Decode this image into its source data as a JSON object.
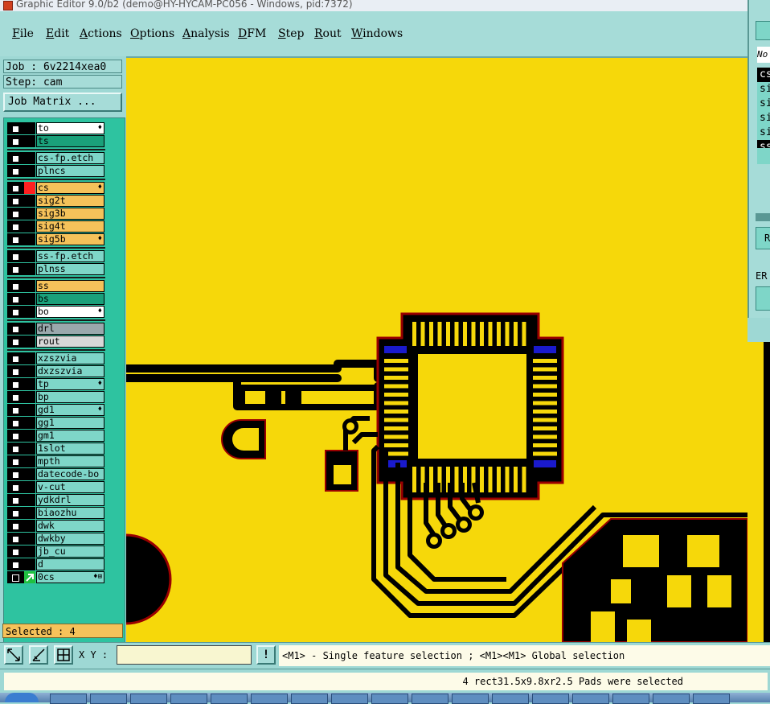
{
  "window": {
    "title": "Graphic Editor 9.0/b2 (demo@HY-HYCAM-PC056 - Windows, pid:7372)"
  },
  "menu": [
    "File",
    "Edit",
    "Actions",
    "Options",
    "Analysis",
    "DFM",
    "Step",
    "Rout",
    "Windows"
  ],
  "job": {
    "label": "Job : 6v2214xea0",
    "step": "Step: cam",
    "matrix_button": "Job Matrix ..."
  },
  "layers": [
    {
      "name": "to",
      "bg": "#ffffff",
      "mark": "♦"
    },
    {
      "name": "ts",
      "bg": "#1aa07a",
      "mark": ""
    },
    {
      "name": "cs-fp.etch",
      "bg": "#7ed6c8",
      "mark": ""
    },
    {
      "name": "plncs",
      "bg": "#7ed6c8",
      "mark": ""
    },
    {
      "name": "cs",
      "bg": "#f5c25a",
      "mark": "♦",
      "color": "#ff2020"
    },
    {
      "name": "sig2t",
      "bg": "#f5c25a",
      "mark": ""
    },
    {
      "name": "sig3b",
      "bg": "#f5c25a",
      "mark": ""
    },
    {
      "name": "sig4t",
      "bg": "#f5c25a",
      "mark": ""
    },
    {
      "name": "sig5b",
      "bg": "#f5c25a",
      "mark": "♦"
    },
    {
      "name": "ss-fp.etch",
      "bg": "#7ed6c8",
      "mark": ""
    },
    {
      "name": "plnss",
      "bg": "#7ed6c8",
      "mark": ""
    },
    {
      "name": "ss",
      "bg": "#f5c25a",
      "mark": ""
    },
    {
      "name": "bs",
      "bg": "#1aa07a",
      "mark": ""
    },
    {
      "name": "bo",
      "bg": "#ffffff",
      "mark": "♦"
    },
    {
      "name": "drl",
      "bg": "#9aa8ac",
      "mark": ""
    },
    {
      "name": "rout",
      "bg": "#d8d8d8",
      "mark": ""
    },
    {
      "name": "xzszvia",
      "bg": "#7ed6c8",
      "mark": ""
    },
    {
      "name": "dxzszvia",
      "bg": "#7ed6c8",
      "mark": ""
    },
    {
      "name": "tp",
      "bg": "#7ed6c8",
      "mark": "♦"
    },
    {
      "name": "bp",
      "bg": "#7ed6c8",
      "mark": ""
    },
    {
      "name": "gd1",
      "bg": "#7ed6c8",
      "mark": "♦"
    },
    {
      "name": "gg1",
      "bg": "#7ed6c8",
      "mark": ""
    },
    {
      "name": "gm1",
      "bg": "#7ed6c8",
      "mark": ""
    },
    {
      "name": "1slot",
      "bg": "#7ed6c8",
      "mark": ""
    },
    {
      "name": "mpth",
      "bg": "#7ed6c8",
      "mark": ""
    },
    {
      "name": "datecode-bo",
      "bg": "#7ed6c8",
      "mark": ""
    },
    {
      "name": "v-cut",
      "bg": "#7ed6c8",
      "mark": ""
    },
    {
      "name": "ydkdrl",
      "bg": "#7ed6c8",
      "mark": ""
    },
    {
      "name": "biaozhu",
      "bg": "#7ed6c8",
      "mark": ""
    },
    {
      "name": "dwk",
      "bg": "#7ed6c8",
      "mark": ""
    },
    {
      "name": "dwkby",
      "bg": "#7ed6c8",
      "mark": ""
    },
    {
      "name": "jb_cu",
      "bg": "#7ed6c8",
      "mark": ""
    },
    {
      "name": "d",
      "bg": "#7ed6c8",
      "mark": ""
    },
    {
      "name": "0cs",
      "bg": "#7ed6c8",
      "mark": "♦⊞",
      "color": "#20c040"
    }
  ],
  "right_panel": {
    "list": [
      "cs",
      "si",
      "si",
      "si",
      "si",
      "ss"
    ],
    "header": "No",
    "button": "R",
    "label": "ER"
  },
  "selected": "Selected : 4",
  "toolbar": {
    "xy_label": "X Y :",
    "xy_value": "",
    "excl": "!"
  },
  "hint": "<M1> - Single feature selection ; <M1><M1> Global selection",
  "status": "4 rect31.5x9.8xr2.5 Pads were selected",
  "colors": {
    "board": "#f6d80a",
    "copper_outline": "#000000",
    "selected_pad": "#1a1acd",
    "panel": "#9ed8d4"
  }
}
